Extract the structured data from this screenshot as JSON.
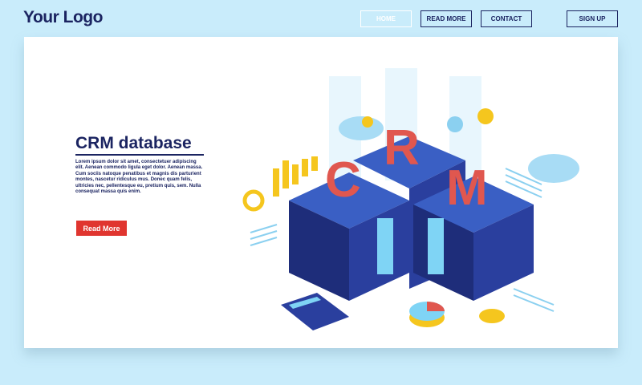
{
  "header": {
    "logo": "Your Logo",
    "nav": [
      {
        "label": "HOME"
      },
      {
        "label": "READ MORE"
      },
      {
        "label": "CONTACT"
      }
    ],
    "signup": "SIGN UP"
  },
  "hero": {
    "title": "CRM database",
    "body": "Lorem ipsum dolor sit amet, consectetuer adipiscing elit. Aenean commodo ligula eget dolor. Aenean massa. Cum sociis natoque penatibus et magnis dis parturient montes, nascetur ridiculus mus. Donec quam felis, ultricies nec, pellentesque eu, pretium quis, sem. Nulla consequat massa quis enim.",
    "button": "Read More"
  },
  "illustration": {
    "letters": [
      "C",
      "R",
      "M"
    ]
  },
  "colors": {
    "navy": "#1b2461",
    "accent": "#e0352f",
    "bg": "#c9ecfb"
  }
}
